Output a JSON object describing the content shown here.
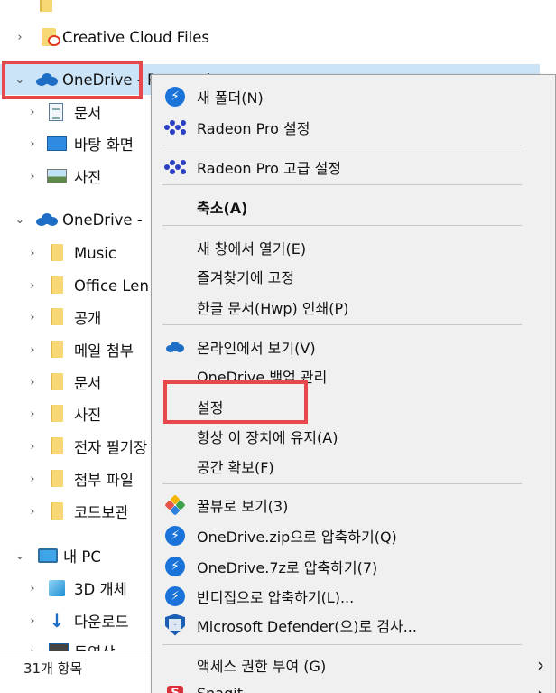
{
  "tree": {
    "top_cut_text": "",
    "items": [
      {
        "label": "Creative Cloud Files",
        "icon": "creative-cloud-folder-icon"
      },
      {
        "label": "OneDrive - Personal",
        "icon": "onedrive-cloud-icon"
      },
      {
        "label": "문서",
        "icon": "document-icon"
      },
      {
        "label": "바탕 화면",
        "icon": "desktop-icon"
      },
      {
        "label": "사진",
        "icon": "pictures-icon"
      },
      {
        "label": "OneDrive -",
        "icon": "onedrive-cloud-icon"
      },
      {
        "label": "Music",
        "icon": "folder-icon"
      },
      {
        "label": "Office Len",
        "icon": "folder-icon"
      },
      {
        "label": "공개",
        "icon": "folder-icon"
      },
      {
        "label": "메일 첨부",
        "icon": "folder-icon"
      },
      {
        "label": "문서",
        "icon": "folder-icon"
      },
      {
        "label": "사진",
        "icon": "folder-icon"
      },
      {
        "label": "전자 필기장",
        "icon": "folder-icon"
      },
      {
        "label": "첨부 파일",
        "icon": "folder-icon"
      },
      {
        "label": "코드보관",
        "icon": "folder-icon"
      },
      {
        "label": "내 PC",
        "icon": "pc-icon"
      },
      {
        "label": "3D 개체",
        "icon": "3d-objects-icon"
      },
      {
        "label": "다운로드",
        "icon": "downloads-icon"
      },
      {
        "label": "동영상",
        "icon": "videos-icon"
      }
    ]
  },
  "status": {
    "item_count": "31개 항목"
  },
  "menu": {
    "items": [
      {
        "label": "새 폴더(N)",
        "icon": "new-folder-icon"
      },
      {
        "label": "Radeon Pro 설정",
        "icon": "radeon-icon"
      },
      {
        "label": "Radeon Pro 고급 설정",
        "icon": "radeon-icon"
      },
      {
        "label": "축소(A)",
        "icon": ""
      },
      {
        "label": "새 창에서 열기(E)",
        "icon": ""
      },
      {
        "label": "즐겨찾기에 고정",
        "icon": ""
      },
      {
        "label": "한글 문서(Hwp) 인쇄(P)",
        "icon": ""
      },
      {
        "label": "온라인에서 보기(V)",
        "icon": "onedrive-cloud-icon"
      },
      {
        "label": "OneDrive 백업 관리",
        "icon": ""
      },
      {
        "label": "설정",
        "icon": ""
      },
      {
        "label": "항상 이 장치에 유지(A)",
        "icon": ""
      },
      {
        "label": "공간 확보(F)",
        "icon": ""
      },
      {
        "label": "꿀뷰로 보기(3)",
        "icon": "honeyview-icon"
      },
      {
        "label": "OneDrive.zip으로 압축하기(Q)",
        "icon": "bandizip-icon"
      },
      {
        "label": "OneDrive.7z로 압축하기(7)",
        "icon": "bandizip-icon"
      },
      {
        "label": "반디집으로 압축하기(L)...",
        "icon": "bandizip-icon"
      },
      {
        "label": "Microsoft Defender(으)로 검사...",
        "icon": "defender-shield-icon"
      },
      {
        "label": "액세스 권한 부여 (G)",
        "icon": "",
        "submenu": true
      },
      {
        "label": "Snagit",
        "icon": "snagit-icon",
        "submenu": true
      }
    ]
  },
  "colors": {
    "highlight": "#e8474b",
    "selection": "#cce4f7",
    "accent": "#1a73d9"
  }
}
